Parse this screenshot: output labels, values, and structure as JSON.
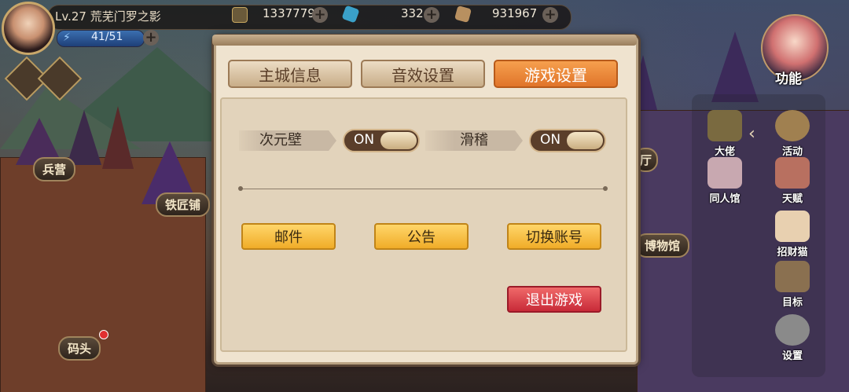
{
  "player": {
    "level_label": "Lv.27",
    "name": "荒芜门罗之影",
    "energy": "41/51",
    "energy_fraction": 0.8
  },
  "resources": [
    {
      "icon": "gold-coin-icon",
      "value": "1337779"
    },
    {
      "icon": "blue-crystal-icon",
      "value": "332"
    },
    {
      "icon": "ore-icon",
      "value": "931967"
    }
  ],
  "buildings": {
    "barracks": "兵营",
    "blacksmith": "铁匠铺",
    "museum": "博物馆",
    "dock": "码头",
    "hall_partial": "厅"
  },
  "right_menu": {
    "function_label": "功能",
    "items": [
      "大佬",
      "活动",
      "同人馆",
      "天赋",
      "招财猫",
      "目标",
      "设置"
    ]
  },
  "modal": {
    "tabs": [
      "主城信息",
      "音效设置",
      "游戏设置"
    ],
    "active_tab": 2,
    "settings": [
      {
        "label": "次元壁",
        "state": "ON"
      },
      {
        "label": "滑稽",
        "state": "ON"
      }
    ],
    "buttons": {
      "mail": "邮件",
      "notice": "公告",
      "switch_account": "切换账号",
      "exit_game": "退出游戏"
    }
  }
}
